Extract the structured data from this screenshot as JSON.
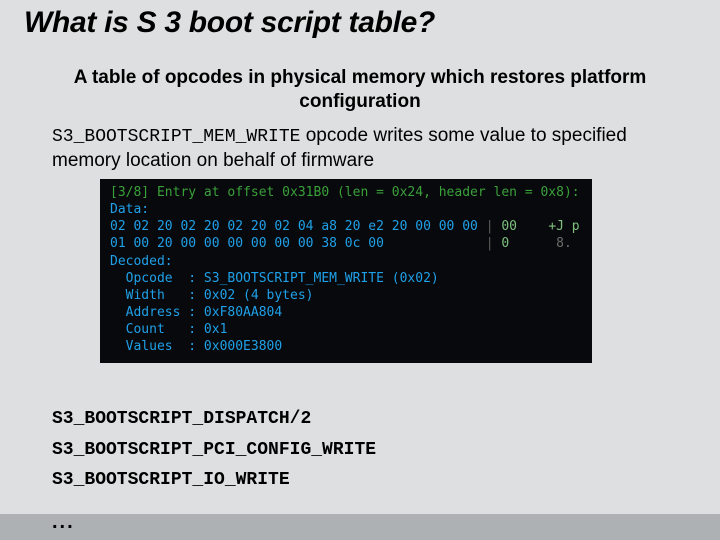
{
  "title": "What is S 3 boot script table?",
  "subtitle": "A table of opcodes in physical memory which restores platform configuration",
  "desc_mono": "S3_BOOTSCRIPT_MEM_WRITE",
  "desc_rest": " opcode writes some value to specified memory location on behalf of firmware",
  "term": {
    "header": "[3/8] Entry at offset 0x31B0 (len = 0x24, header len = 0x8):",
    "data_label": "Data:",
    "hex1": "02 02 20 02 20 02 20 02 04 a8 20 e2 20 00 00 00",
    "asc1_a": "00",
    "asc1_b": "+J p",
    "hex2": "01 00 20 00 00 00 00 00 00 38 0c 00",
    "asc2_a": "0",
    "asc2_b": "8.",
    "decoded_label": "Decoded:",
    "opcode": "  Opcode  : S3_BOOTSCRIPT_MEM_WRITE (0x02)",
    "width": "  Width   : 0x02 (4 bytes)",
    "address": "  Address : 0xF80AA804",
    "count": "  Count   : 0x1",
    "values": "  Values  : 0x000E3800"
  },
  "oplist": {
    "a": "S3_BOOTSCRIPT_DISPATCH/2",
    "b": "S3_BOOTSCRIPT_PCI_CONFIG_WRITE",
    "c": "S3_BOOTSCRIPT_IO_WRITE"
  },
  "ellipsis": "..."
}
